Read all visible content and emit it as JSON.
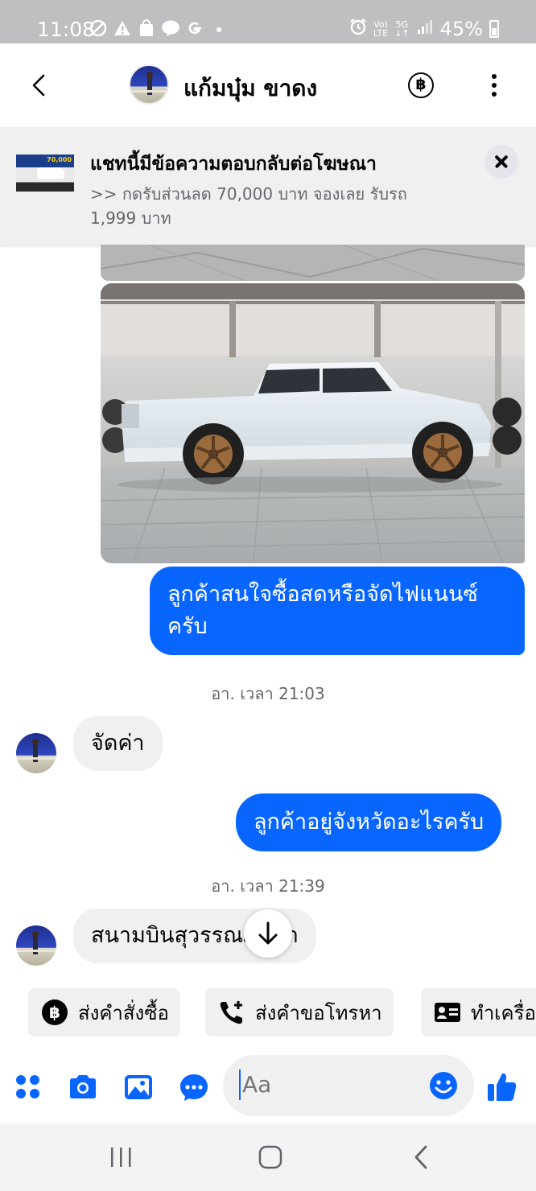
{
  "status_bar": {
    "time": "11:08",
    "battery": "45%",
    "network_top": "Vo)",
    "network_bottom": "LTE",
    "gen": "5G"
  },
  "header": {
    "contact_name": "แก้มบุ๋ม ขาดง",
    "baht_symbol": "฿"
  },
  "ad_banner": {
    "thumbnail_text": "70,000",
    "title": "แชทนี้มีข้อความตอบกลับต่อโฆษณา",
    "subtitle": ">> กดรับส่วนลด 70,000 บาท จองเลย รับรถ 1,999 บาท"
  },
  "messages": [
    {
      "type": "outgoing",
      "text": "ลูกค้าสนใจซื้อสดหรือจัดไฟแนนซ์ครับ"
    },
    {
      "type": "timestamp",
      "text": "อา. เวลา 21:03"
    },
    {
      "type": "incoming",
      "text": "จัดค่า"
    },
    {
      "type": "outgoing",
      "text": "ลูกค้าอยู่จังหวัดอะไรครับ"
    },
    {
      "type": "timestamp",
      "text": "อา. เวลา 21:39"
    },
    {
      "type": "incoming",
      "text": "สนามบินสุวรรณภูมิค่า"
    }
  ],
  "quick_replies": [
    {
      "label": "ส่งคำสั่งซื้อ",
      "icon": "baht-circle-icon"
    },
    {
      "label": "ส่งคำขอโทรหา",
      "icon": "phone-plus-icon"
    },
    {
      "label": "ทำเครื่อง",
      "icon": "contact-card-icon"
    }
  ],
  "composer": {
    "placeholder": "Aa"
  },
  "colors": {
    "accent": "#0866ff",
    "bubble_in": "#f0f0f0",
    "status_bar": "#bfbfc2"
  }
}
